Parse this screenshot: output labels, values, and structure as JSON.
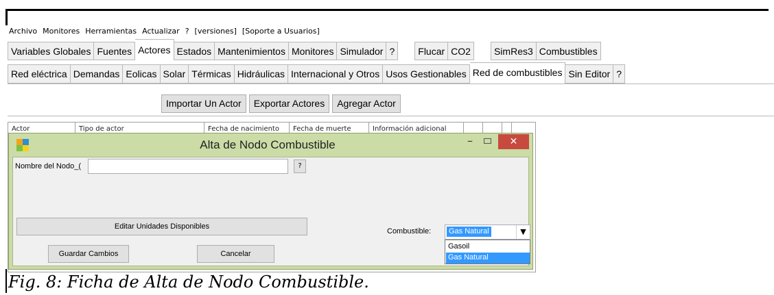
{
  "menubar": {
    "items": [
      "Archivo",
      "Monitores",
      "Herramientas",
      "Actualizar",
      "?",
      "[versiones]",
      "[Soporte a Usuarios]"
    ]
  },
  "main_tabs": [
    {
      "label": "Variables Globales"
    },
    {
      "label": "Fuentes"
    },
    {
      "label": "Actores",
      "active": true
    },
    {
      "label": "Estados"
    },
    {
      "label": "Mantenimientos"
    },
    {
      "label": "Monitores"
    },
    {
      "label": "Simulador"
    },
    {
      "label": "?"
    },
    {
      "label": "Flucar"
    },
    {
      "label": "CO2"
    },
    {
      "label": "SimRes3"
    },
    {
      "label": "Combustibles"
    }
  ],
  "sub_tabs": [
    {
      "label": "Red eléctrica"
    },
    {
      "label": "Demandas"
    },
    {
      "label": "Eolicas"
    },
    {
      "label": "Solar"
    },
    {
      "label": "Térmicas"
    },
    {
      "label": "Hidráulicas"
    },
    {
      "label": "Internacional y Otros"
    },
    {
      "label": "Usos Gestionables"
    },
    {
      "label": "Red de combustibles",
      "active": true
    },
    {
      "label": "Sin Editor"
    },
    {
      "label": "?"
    }
  ],
  "toolbar": {
    "import_label": "Importar Un Actor",
    "export_label": "Exportar Actores",
    "add_label": "Agregar Actor"
  },
  "grid": {
    "columns": [
      "Actor",
      "Tipo de actor",
      "Fecha de nacimiento",
      "Fecha de muerte",
      "Información adicional",
      "",
      "",
      ""
    ]
  },
  "dialog": {
    "title": "Alta de Nodo Combustible",
    "minimize_glyph": "–",
    "close_glyph": "✕",
    "node_name_label": "Nombre del Nodo_(",
    "node_name_value": "",
    "help_label": "?",
    "edit_units_label": "Editar Unidades Disponibles",
    "fuel_label": "Combustible:",
    "fuel_selected": "Gas Natural",
    "fuel_arrow": "▼",
    "fuel_options": [
      "Gasoil",
      "Gas Natural"
    ],
    "save_label": "Guardar Cambios",
    "cancel_label": "Cancelar"
  },
  "caption": "Fig. 8: Ficha de Alta de Nodo Combustible.",
  "colors": {
    "dialog_frame": "#cbdca6",
    "close_button": "#c74a3f",
    "selection": "#3399ff"
  }
}
